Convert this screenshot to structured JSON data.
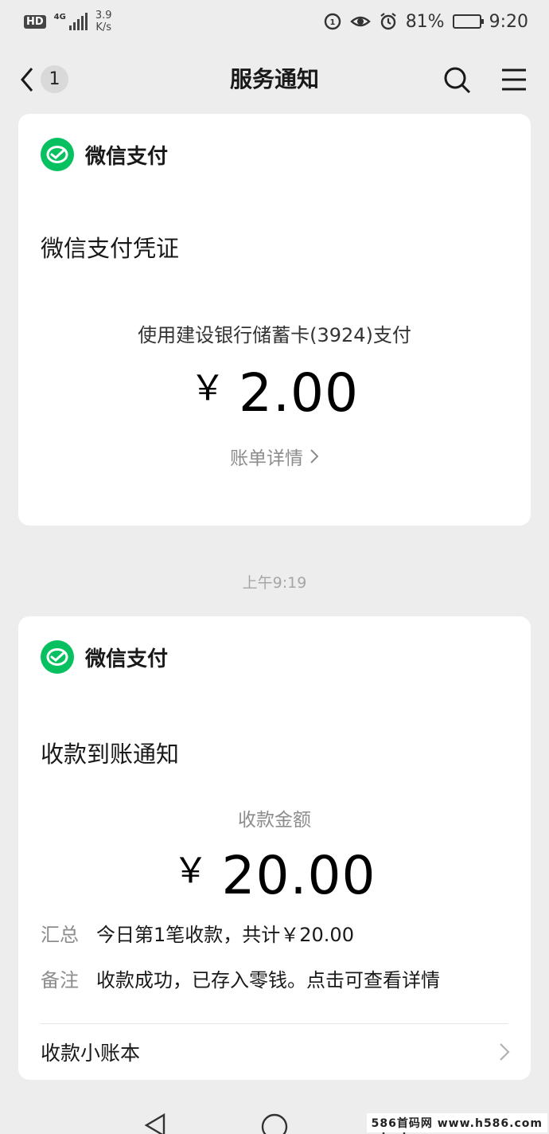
{
  "status_bar": {
    "hd": "HD",
    "network": "4G",
    "speed_value": "3.9",
    "speed_unit": "K/s",
    "battery_percent": "81%",
    "battery_level": 0.81,
    "time": "9:20"
  },
  "header": {
    "back_count": "1",
    "title": "服务通知"
  },
  "cards": [
    {
      "brand": "微信支付",
      "title": "微信支付凭证",
      "pay_method": "使用建设银行储蓄卡(3924)支付",
      "currency": "￥",
      "amount": "2.00",
      "detail_link": "账单详情"
    },
    {
      "brand": "微信支付",
      "title": "收款到账通知",
      "amount_label": "收款金额",
      "currency": "￥",
      "amount": "20.00",
      "summary_key": "汇总",
      "summary_value": "今日第1笔收款，共计￥20.00",
      "note_key": "备注",
      "note_value": "收款成功，已存入零钱。点击可查看详情",
      "ledger_label": "收款小账本"
    }
  ],
  "timestamp": "上午9:19",
  "watermark": "586首码网 www.h586.com",
  "colors": {
    "wechat_pay_green": "#07c160",
    "background": "#ededed",
    "card": "#ffffff"
  }
}
